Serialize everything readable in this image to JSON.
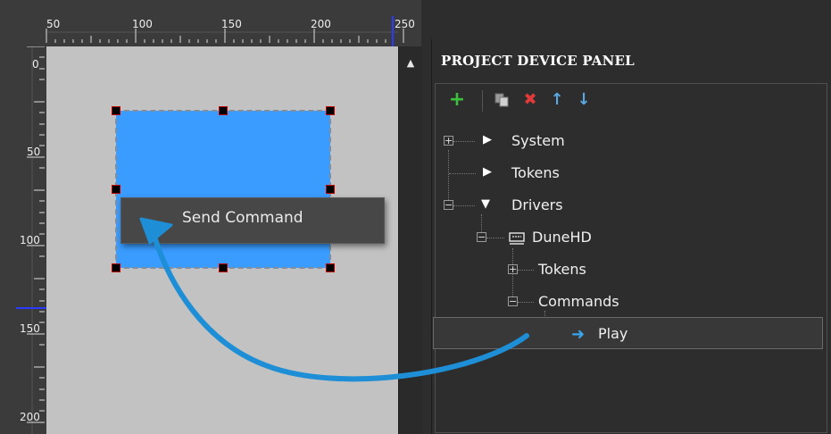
{
  "rulers": {
    "top_ticks": [
      "50",
      "100",
      "150",
      "200",
      "250"
    ],
    "left_ticks": [
      "0",
      "50",
      "100",
      "150",
      "200"
    ]
  },
  "popup": {
    "label": "Send Command"
  },
  "panel": {
    "title": "PROJECT DEVICE PANEL",
    "toolbar": [
      {
        "name": "add",
        "icon": "plus-icon",
        "color": "#3cc13c"
      },
      {
        "name": "copy",
        "icon": "copy-icon",
        "color": "#bdbdbd"
      },
      {
        "name": "delete",
        "icon": "delete-icon",
        "color": "#e23a3a"
      },
      {
        "name": "move-up",
        "icon": "arrow-up-icon",
        "color": "#5aa8e0"
      },
      {
        "name": "move-down",
        "icon": "arrow-down-icon",
        "color": "#5aa8e0"
      }
    ],
    "tree": {
      "system": "System",
      "tokens_root": "Tokens",
      "drivers": "Drivers",
      "device": "DuneHD",
      "device_tokens": "Tokens",
      "commands": "Commands",
      "play": "Play"
    }
  },
  "colors": {
    "widget": "#3a9cff",
    "canvas": "#c2c2c2",
    "drag_arrow": "#1e8fd6",
    "accent_blue": "#2a7fff"
  }
}
